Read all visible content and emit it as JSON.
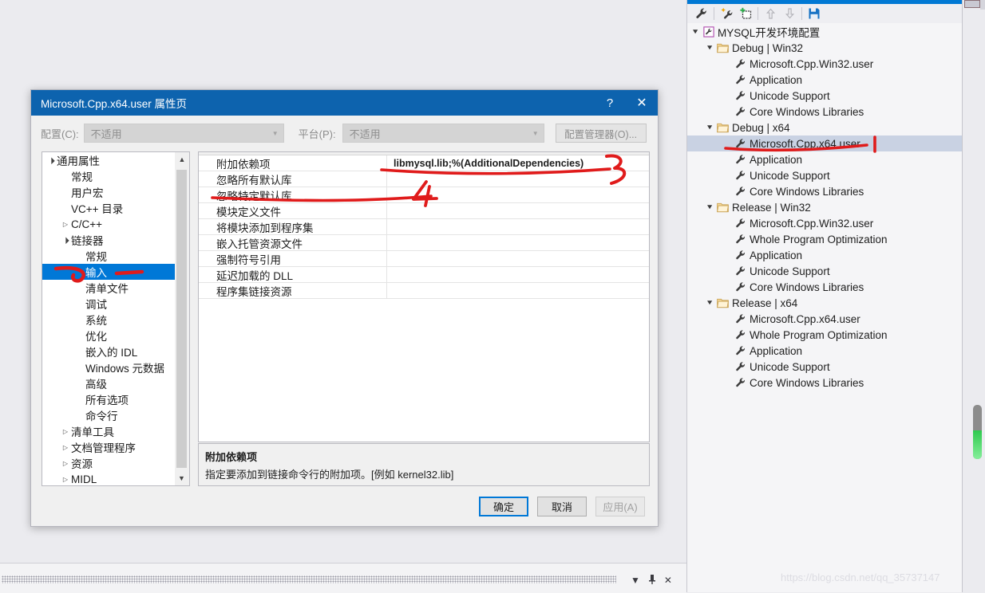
{
  "dialog": {
    "title": "Microsoft.Cpp.x64.user 属性页",
    "help_button": "?",
    "close_button": "✕",
    "config": {
      "config_label": "配置(C):",
      "config_value": "不适用",
      "platform_label": "平台(P):",
      "platform_value": "不适用",
      "config_manager_button": "配置管理器(O)..."
    },
    "nav_tree": [
      {
        "label": "通用属性",
        "level": 0,
        "expander": "expanded",
        "selected": false
      },
      {
        "label": "常规",
        "level": 1,
        "expander": "none",
        "selected": false
      },
      {
        "label": "用户宏",
        "level": 1,
        "expander": "none",
        "selected": false
      },
      {
        "label": "VC++ 目录",
        "level": 1,
        "expander": "none",
        "selected": false
      },
      {
        "label": "C/C++",
        "level": 1,
        "expander": "collapsed",
        "selected": false
      },
      {
        "label": "链接器",
        "level": 1,
        "expander": "expanded",
        "selected": false
      },
      {
        "label": "常规",
        "level": 2,
        "expander": "none",
        "selected": false
      },
      {
        "label": "输入",
        "level": 2,
        "expander": "none",
        "selected": true
      },
      {
        "label": "清单文件",
        "level": 2,
        "expander": "none",
        "selected": false
      },
      {
        "label": "调试",
        "level": 2,
        "expander": "none",
        "selected": false
      },
      {
        "label": "系统",
        "level": 2,
        "expander": "none",
        "selected": false
      },
      {
        "label": "优化",
        "level": 2,
        "expander": "none",
        "selected": false
      },
      {
        "label": "嵌入的 IDL",
        "level": 2,
        "expander": "none",
        "selected": false
      },
      {
        "label": "Windows 元数据",
        "level": 2,
        "expander": "none",
        "selected": false
      },
      {
        "label": "高级",
        "level": 2,
        "expander": "none",
        "selected": false
      },
      {
        "label": "所有选项",
        "level": 2,
        "expander": "none",
        "selected": false
      },
      {
        "label": "命令行",
        "level": 2,
        "expander": "none",
        "selected": false
      },
      {
        "label": "清单工具",
        "level": 1,
        "expander": "collapsed",
        "selected": false
      },
      {
        "label": "文档管理程序",
        "level": 1,
        "expander": "collapsed",
        "selected": false
      },
      {
        "label": "资源",
        "level": 1,
        "expander": "collapsed",
        "selected": false
      },
      {
        "label": "MIDL",
        "level": 1,
        "expander": "collapsed",
        "selected": false
      }
    ],
    "grid_rows": [
      {
        "name": "附加依赖项",
        "value": "libmysql.lib;%(AdditionalDependencies)"
      },
      {
        "name": "忽略所有默认库",
        "value": ""
      },
      {
        "name": "忽略特定默认库",
        "value": ""
      },
      {
        "name": "模块定义文件",
        "value": ""
      },
      {
        "name": "将模块添加到程序集",
        "value": ""
      },
      {
        "name": "嵌入托管资源文件",
        "value": ""
      },
      {
        "name": "强制符号引用",
        "value": ""
      },
      {
        "name": "延迟加载的 DLL",
        "value": ""
      },
      {
        "name": "程序集链接资源",
        "value": ""
      }
    ],
    "description": {
      "title": "附加依赖项",
      "text": "指定要添加到链接命令行的附加项。[例如 kernel32.lib]"
    },
    "buttons": {
      "ok": "确定",
      "cancel": "取消",
      "apply": "应用(A)"
    }
  },
  "explorer": {
    "toolbar": [
      {
        "icon": "wrench-icon"
      },
      {
        "icon": "wrench-sparkle-icon"
      },
      {
        "icon": "add-property-sheet-icon"
      },
      {
        "icon": "move-up-arrow-icon"
      },
      {
        "icon": "move-down-arrow-icon"
      },
      {
        "icon": "save-icon"
      }
    ],
    "tree": [
      {
        "label": "MYSQL开发环境配置",
        "level": 1,
        "icon": "project-icon",
        "expander": "expanded",
        "selected": false
      },
      {
        "label": "Debug | Win32",
        "level": 2,
        "icon": "folder-icon",
        "expander": "expanded",
        "selected": false
      },
      {
        "label": "Microsoft.Cpp.Win32.user",
        "level": 3,
        "icon": "wrench-icon",
        "expander": "none",
        "selected": false
      },
      {
        "label": "Application",
        "level": 3,
        "icon": "wrench-icon",
        "expander": "none",
        "selected": false
      },
      {
        "label": "Unicode Support",
        "level": 3,
        "icon": "wrench-icon",
        "expander": "none",
        "selected": false
      },
      {
        "label": "Core Windows Libraries",
        "level": 3,
        "icon": "wrench-icon",
        "expander": "none",
        "selected": false
      },
      {
        "label": "Debug | x64",
        "level": 2,
        "icon": "folder-icon",
        "expander": "expanded",
        "selected": false
      },
      {
        "label": "Microsoft.Cpp.x64.user",
        "level": 3,
        "icon": "wrench-icon",
        "expander": "none",
        "selected": true
      },
      {
        "label": "Application",
        "level": 3,
        "icon": "wrench-icon",
        "expander": "none",
        "selected": false
      },
      {
        "label": "Unicode Support",
        "level": 3,
        "icon": "wrench-icon",
        "expander": "none",
        "selected": false
      },
      {
        "label": "Core Windows Libraries",
        "level": 3,
        "icon": "wrench-icon",
        "expander": "none",
        "selected": false
      },
      {
        "label": "Release | Win32",
        "level": 2,
        "icon": "folder-icon",
        "expander": "expanded",
        "selected": false
      },
      {
        "label": "Microsoft.Cpp.Win32.user",
        "level": 3,
        "icon": "wrench-icon",
        "expander": "none",
        "selected": false
      },
      {
        "label": "Whole Program Optimization",
        "level": 3,
        "icon": "wrench-icon",
        "expander": "none",
        "selected": false
      },
      {
        "label": "Application",
        "level": 3,
        "icon": "wrench-icon",
        "expander": "none",
        "selected": false
      },
      {
        "label": "Unicode Support",
        "level": 3,
        "icon": "wrench-icon",
        "expander": "none",
        "selected": false
      },
      {
        "label": "Core Windows Libraries",
        "level": 3,
        "icon": "wrench-icon",
        "expander": "none",
        "selected": false
      },
      {
        "label": "Release | x64",
        "level": 2,
        "icon": "folder-icon",
        "expander": "expanded",
        "selected": false
      },
      {
        "label": "Microsoft.Cpp.x64.user",
        "level": 3,
        "icon": "wrench-icon",
        "expander": "none",
        "selected": false
      },
      {
        "label": "Whole Program Optimization",
        "level": 3,
        "icon": "wrench-icon",
        "expander": "none",
        "selected": false
      },
      {
        "label": "Application",
        "level": 3,
        "icon": "wrench-icon",
        "expander": "none",
        "selected": false
      },
      {
        "label": "Unicode Support",
        "level": 3,
        "icon": "wrench-icon",
        "expander": "none",
        "selected": false
      },
      {
        "label": "Core Windows Libraries",
        "level": 3,
        "icon": "wrench-icon",
        "expander": "none",
        "selected": false
      }
    ]
  },
  "bottom_panel": {
    "dropdown_icon": "▼",
    "pin_icon": "pin",
    "close_icon": "✕"
  },
  "annotations": {
    "marker_1": "1",
    "marker_2": "2",
    "marker_4": "4",
    "color": "#e01b1b"
  },
  "watermark": "https://blog.csdn.net/qq_35737147"
}
